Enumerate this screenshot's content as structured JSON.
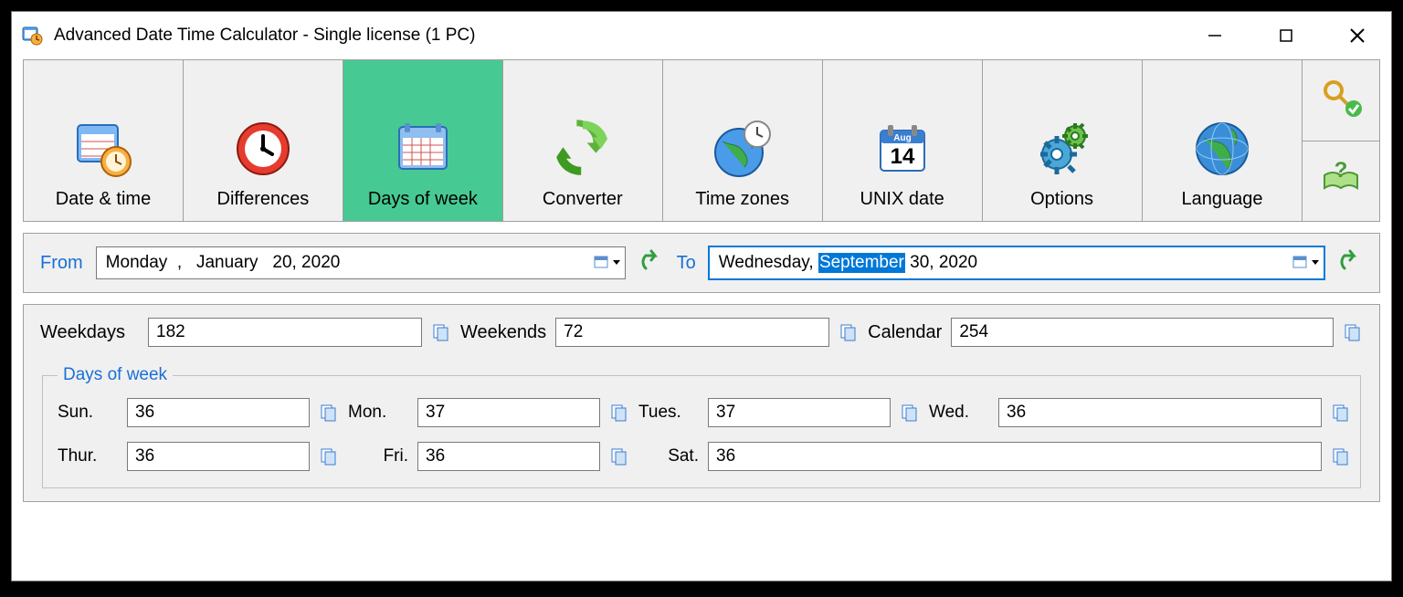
{
  "title": "Advanced Date Time Calculator - Single license (1 PC)",
  "toolbar": {
    "items": [
      {
        "label": "Date & time"
      },
      {
        "label": "Differences"
      },
      {
        "label": "Days of week"
      },
      {
        "label": "Converter"
      },
      {
        "label": "Time zones"
      },
      {
        "label": "UNIX date"
      },
      {
        "label": "Options"
      },
      {
        "label": "Language"
      }
    ],
    "active_index": 2
  },
  "range": {
    "from_label": "From",
    "from_value_before": "Monday  ,   January   20, 2020",
    "to_label": "To",
    "to_before": "Wednesday, ",
    "to_highlight": "September",
    "to_after": " 30, 2020"
  },
  "summary": {
    "weekdays_label": "Weekdays",
    "weekdays": "182",
    "weekends_label": "Weekends",
    "weekends": "72",
    "calendar_label": "Calendar",
    "calendar": "254"
  },
  "dow": {
    "legend": "Days of week",
    "sun_label": "Sun.",
    "sun": "36",
    "mon_label": "Mon.",
    "mon": "37",
    "tue_label": "Tues.",
    "tue": "37",
    "wed_label": "Wed.",
    "wed": "36",
    "thu_label": "Thur.",
    "thu": "36",
    "fri_label": "Fri.",
    "fri": "36",
    "sat_label": "Sat.",
    "sat": "36"
  }
}
